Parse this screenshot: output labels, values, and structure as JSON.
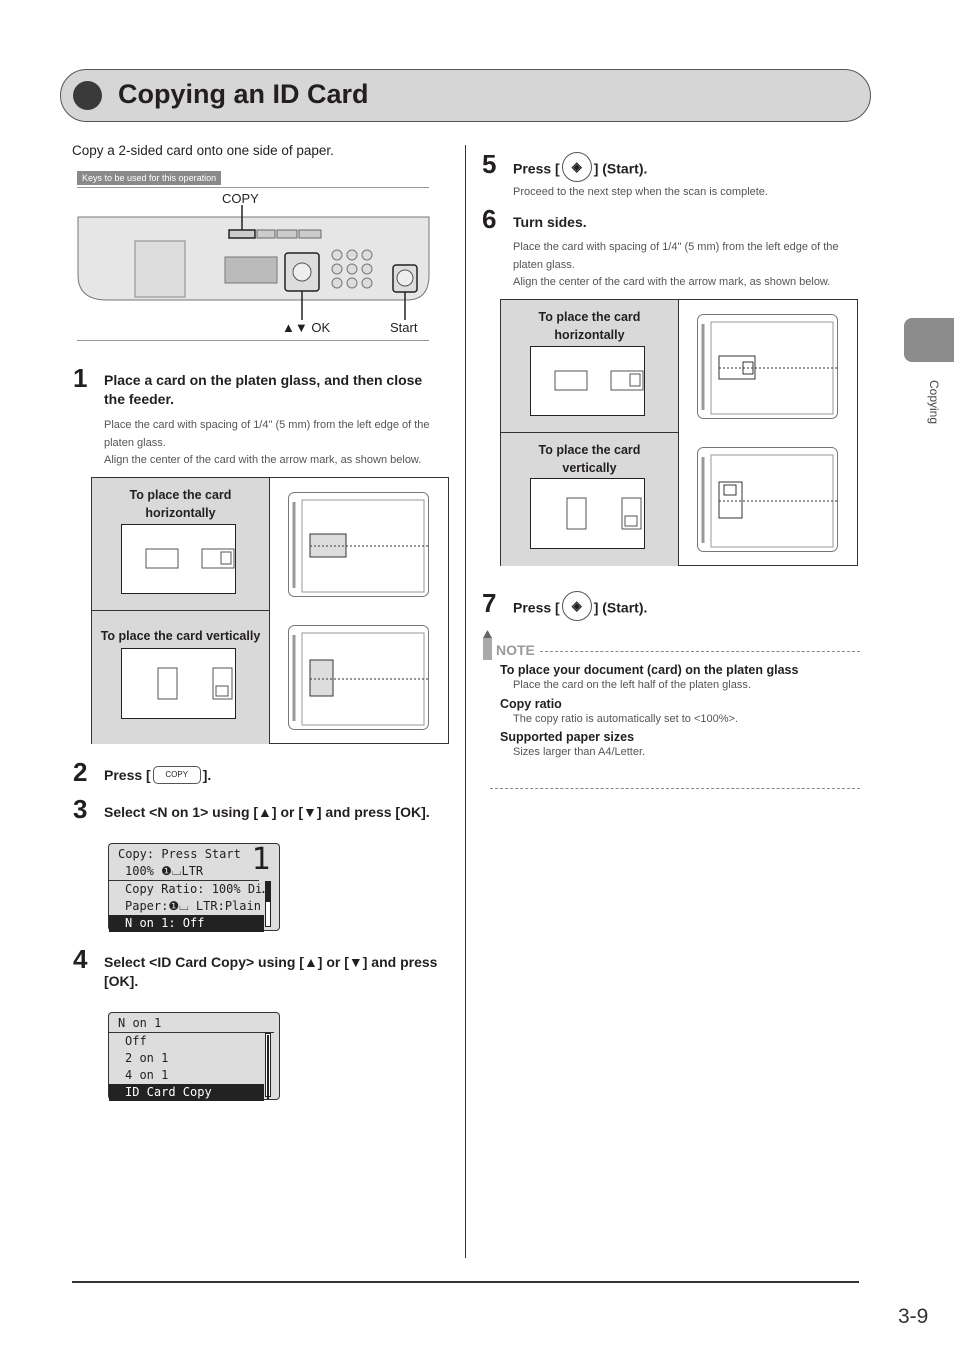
{
  "header": {
    "title": "Copying an ID Card"
  },
  "intro": "Copy a 2-sided card onto one side of paper.",
  "keys_label": "Keys to be used for this operation",
  "panel": {
    "copy_label": "COPY",
    "ok_label": "▲▼ OK",
    "start_label": "Start"
  },
  "steps": [
    {
      "num": "1",
      "title": "Place a card on the platen glass, and then close the feeder.",
      "body": [
        "Place the card with spacing of 1/4\" (5 mm) from the left edge of the platen glass.",
        "Align the center of the card with the arrow mark, as shown below."
      ]
    },
    {
      "num": "2",
      "pre": "Press [",
      "button": "COPY",
      "post": "]."
    },
    {
      "num": "3",
      "title": "Select <N on 1> using [▲] or [▼] and press [OK]."
    },
    {
      "num": "4",
      "title": "Select <ID Card Copy> using [▲] or [▼] and press [OK]."
    },
    {
      "num": "5",
      "pre": "Press [",
      "post": "] (Start).",
      "body": "Proceed to the next step when the scan is complete."
    },
    {
      "num": "6",
      "title": "Turn sides.",
      "body": [
        "Place the card with spacing of 1/4\" (5 mm) from the left edge of the platen glass.",
        "Align the center of the card with the arrow mark, as shown below."
      ]
    },
    {
      "num": "7",
      "pre": "Press [",
      "post": "] (Start)."
    }
  ],
  "placement": {
    "horizontal": "To place the card horizontally",
    "vertical": "To place the card vertically"
  },
  "lcd1": {
    "line1": "Copy: Press Start",
    "line2": "100% ❶⌴LTR",
    "count": "1",
    "items": [
      "Copy Ratio: 100% Di…",
      "Paper:❶⌴ LTR:Plain",
      "N on 1: Off"
    ]
  },
  "lcd2": {
    "title": "N on 1",
    "items": [
      "Off",
      "2 on 1",
      "4 on 1",
      "ID Card Copy"
    ]
  },
  "note": {
    "label": "NOTE",
    "items": [
      {
        "heading": "To place your document (card) on the platen glass",
        "text": "Place the card on the left half of the platen glass."
      },
      {
        "heading": "Copy ratio",
        "text": "The copy ratio is automatically set to <100%>."
      },
      {
        "heading": "Supported paper sizes",
        "text": "Sizes larger than A4/Letter."
      }
    ]
  },
  "side_tab": "Copying",
  "page_number": "3-9"
}
